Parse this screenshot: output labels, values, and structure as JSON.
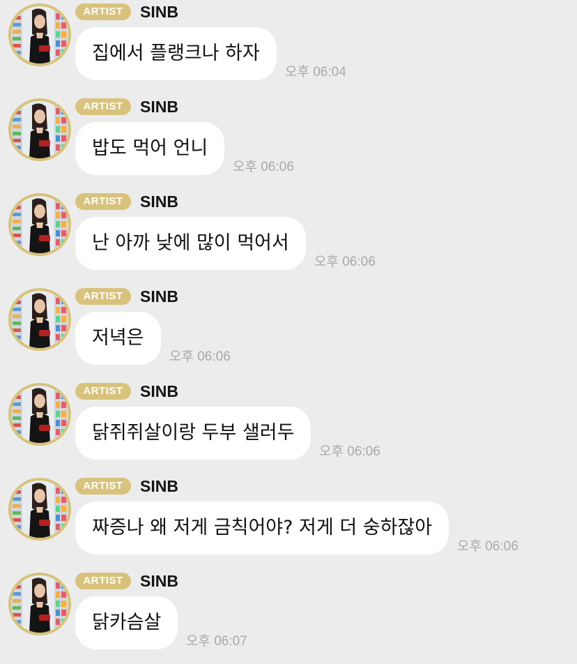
{
  "sender": {
    "badge": "ARTIST",
    "name": "SINB",
    "avatar_icon": "profile-photo-avatar"
  },
  "colors": {
    "background": "#ececec",
    "bubble": "#ffffff",
    "badge": "#d9c37c",
    "avatar_ring": "#d8c27a",
    "timestamp": "#a8a8a8"
  },
  "messages": [
    {
      "text": "집에서 플랭크나 하자",
      "time": "오후 06:04"
    },
    {
      "text": "밥도 먹어 언니",
      "time": "오후 06:06"
    },
    {
      "text": "난 아까 낮에 많이 먹어서",
      "time": "오후 06:06"
    },
    {
      "text": "저녁은",
      "time": "오후 06:06"
    },
    {
      "text": "닭쥐쥐살이랑 두부 샐러두",
      "time": "오후 06:06"
    },
    {
      "text": "짜증나 왜 저게 금칙어야? 저게 더 숭하잖아",
      "time": "오후 06:06"
    },
    {
      "text": "닭카슴살",
      "time": "오후 06:07"
    }
  ]
}
